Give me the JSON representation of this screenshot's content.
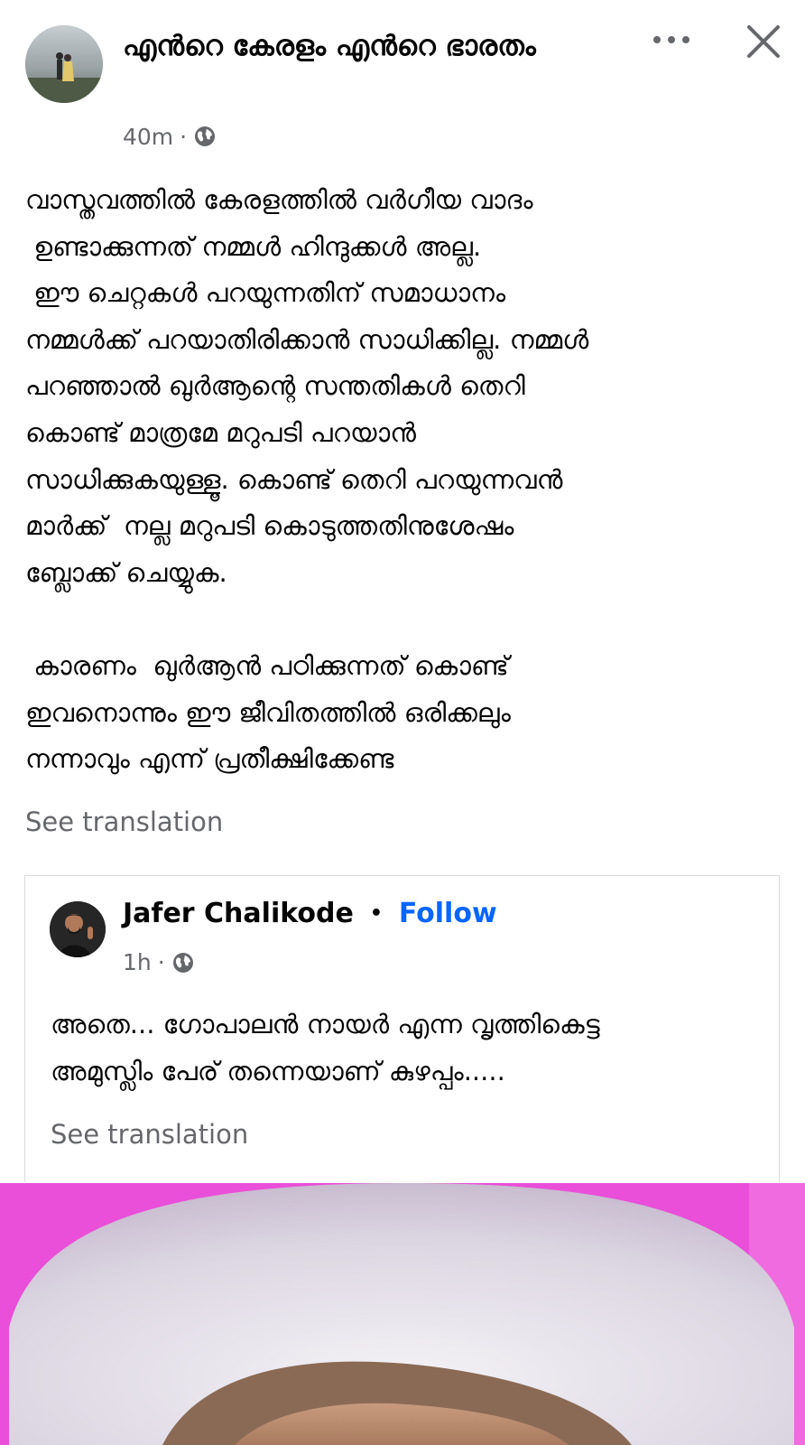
{
  "header": {
    "page_name": "എൻറെ കേരളം എൻറെ ഭാരതം",
    "time": "40m",
    "dot": "·",
    "privacy_icon": "globe-icon",
    "more_icon": "more-dots-icon",
    "close_icon": "close-icon"
  },
  "post": {
    "lines": [
      "വാസ്തവത്തിൽ കേരളത്തിൽ വർഗീയ വാദം",
      " ഉണ്ടാക്കുന്നത് നമ്മൾ ഹിന്ദുക്കൾ അല്ല.",
      " ഈ ചെറ്റകൾ പറയുന്നതിന് സമാധാനം",
      "നമ്മൾക്ക് പറയാതിരിക്കാൻ സാധിക്കില്ല. നമ്മൾ",
      "പറഞ്ഞാൽ ഖുർആന്റെ സന്തതികൾ തെറി",
      "കൊണ്ട് മാത്രമേ മറുപടി പറയാൻ",
      "സാധിക്കുകയുള്ളൂ. കൊണ്ട് തെറി പറയുന്നവൻ",
      "മാർക്ക്  നല്ല മറുപടി കൊടുത്തതിനുശേഷം",
      "ബ്ലോക്ക് ചെയ്യുക."
    ],
    "lines2": [
      " കാരണം  ഖുർആൻ പഠിക്കുന്നത് കൊണ്ട്",
      "ഇവനൊന്നും ഈ ജീവിതത്തിൽ ഒരിക്കലും",
      "നന്നാവും എന്ന് പ്രതീക്ഷിക്കേണ്ട"
    ],
    "see_translation": "See translation"
  },
  "shared": {
    "user_name": "Jafer Chalikode",
    "sep": "•",
    "follow": "Follow",
    "time": "1h",
    "dot": "·",
    "lines": [
      "അതെ... ഗോപാലൻ നായർ എന്ന വൃത്തികെട്ട",
      "അമുസ്ലിം പേര് തന്നെയാണ് കുഴപ്പം....."
    ],
    "see_translation": "See translation"
  },
  "colors": {
    "accent": "#0866ff",
    "secondary_text": "#65676b",
    "photo_bg": "#e94fd8"
  }
}
